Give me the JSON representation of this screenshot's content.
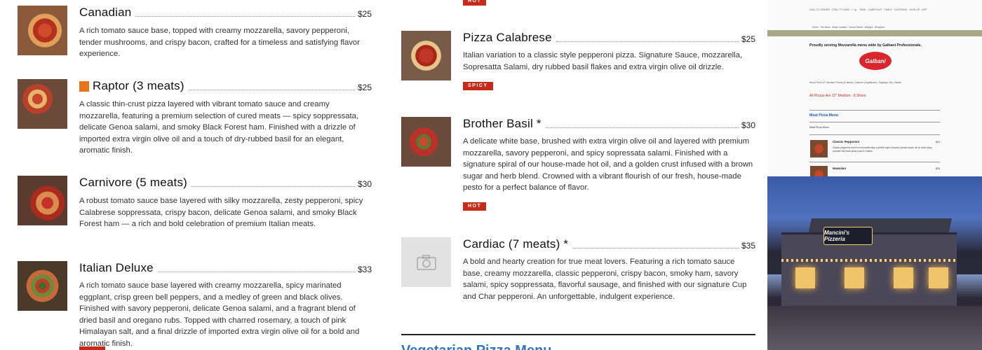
{
  "menu_left": [
    {
      "name": "Canadian",
      "price": "$25",
      "desc": "A rich tomato sauce base, topped with creamy mozzarella, savory pepperoni, tender mushrooms, and crispy bacon, crafted for a timeless and satisfying flavor experience."
    },
    {
      "name": "Raptor (3 meats)",
      "price": "$25",
      "desc": "A classic thin-crust pizza layered with vibrant tomato sauce and creamy mozzarella, featuring a premium selection of cured meats — spicy soppressata, delicate Genoa salami, and smoky Black Forest ham. Finished with a drizzle of imported extra virgin olive oil and a touch of dry-rubbed basil for an elegant, aromatic finish."
    },
    {
      "name": "Carnivore (5 meats)",
      "price": "$30",
      "desc": "A robust tomato sauce base layered with silky mozzarella, zesty pepperoni, spicy Calabrese soppressata, crispy bacon, delicate Genoa salami, and smoky Black Forest ham — a rich and bold celebration of premium Italian meats."
    },
    {
      "name": "Italian Deluxe",
      "price": "$33",
      "desc": "A rich tomato sauce base layered with creamy mozzarella, spicy marinated eggplant, crisp green bell peppers, and a medley of green and black olives. Finished with savory pepperoni, delicate Genoa salami, and a fragrant blend of dried basil and oregano rubs. Topped with charred rosemary, a touch of pink Himalayan salt, and a final drizzle of imported extra virgin olive oil for a bold and aromatic finish."
    }
  ],
  "menu_right": [
    {
      "name": "Pizza Calabrese",
      "price": "$25",
      "desc": "Italian variation to a classic style pepperoni pizza. Signature Sauce, mozzarella, Sopresatta Salami, dry rubbed basil flakes and extra virgin olive oil drizzle.",
      "tag": "SPICY"
    },
    {
      "name": "Brother Basil *",
      "price": "$30",
      "desc": "A delicate white base, brushed with extra virgin olive oil and layered with premium mozzarella, savory pepperoni, and spicy sopressata salami. Finished with a signature spiral of our house-made hot oil, and a golden crust infused with a brown sugar and herb blend. Crowned with a vibrant flourish of our fresh, house-made pesto for a perfect balance of flavor.",
      "tag": "HOT"
    },
    {
      "name": "Cardiac (7 meats) *",
      "price": "$35",
      "desc": "A bold and hearty creation for true meat lovers. Featuring a rich tomato sauce base, creamy mozzarella, classic pepperoni, crispy bacon, smoky ham, savory salami, spicy soppressata, flavorful sausage, and finished with our signature Cup and Char pepperoni. An unforgettable, indulgent experience."
    }
  ],
  "top_tag": "HOT",
  "veg_heading": "Vegetarian Pizza Menu",
  "screenshot_panel": {
    "tagline": "Proudly serving Mozzarella menu wide by Galbani Professionale.",
    "logo_text": "Galbani",
    "sub_price_note": "All Pizzas Are 12\" Medium - 8 Slices",
    "section_title": "Meat Pizza Menu",
    "section_sub": "Meat Pizza Menu",
    "item1": "Classic Pepperoni",
    "item1_price": "$22",
    "item2": "Hawaiian",
    "item2_price": "$25"
  },
  "storefront_sign": "Mancini's Pizzeria",
  "icons": {
    "placeholder": "camera-icon",
    "badge": "ribbon-icon"
  },
  "colors": {
    "tag_red": "#c62a1a",
    "heading_blue": "#2a77c4",
    "badge_orange": "#e8751a"
  }
}
